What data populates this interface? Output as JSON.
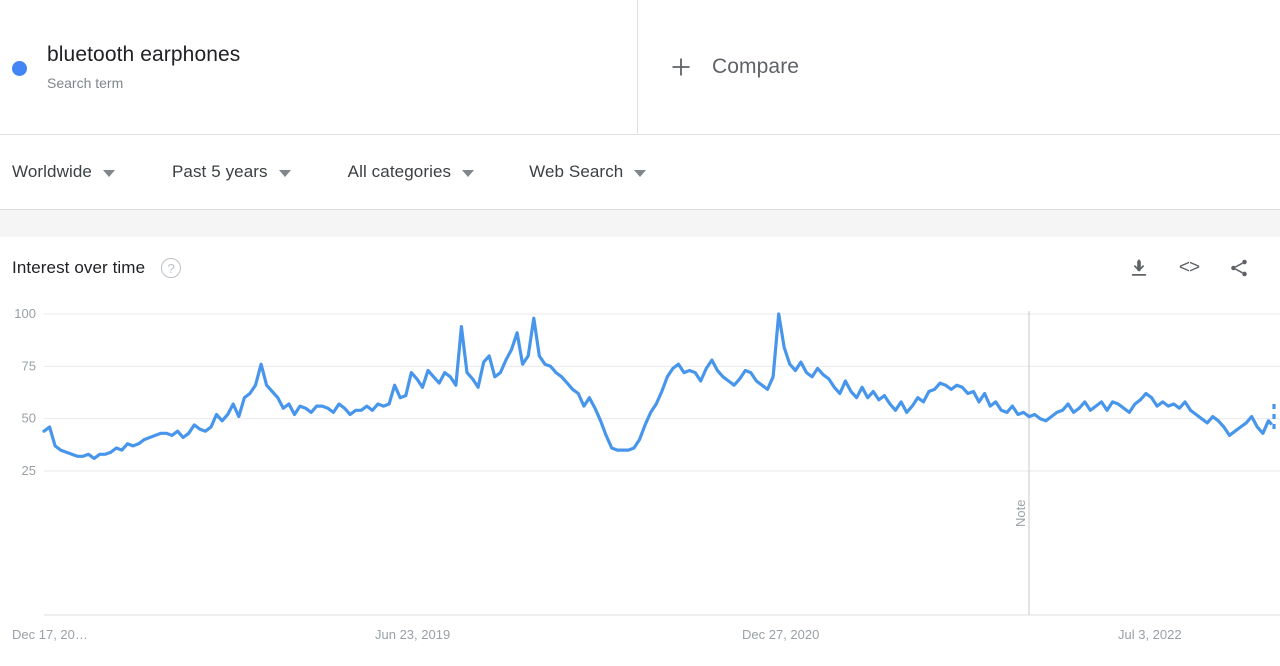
{
  "header": {
    "term": {
      "title": "bluetooth earphones",
      "subtitle": "Search term",
      "dot_color": "#4285f4"
    },
    "compare": {
      "label": "Compare",
      "icon": "plus-icon"
    }
  },
  "filters": [
    {
      "label": "Worldwide",
      "caret": "chevron-down-icon"
    },
    {
      "label": "Past 5 years",
      "caret": "chevron-down-icon"
    },
    {
      "label": "All categories",
      "caret": "chevron-down-icon"
    },
    {
      "label": "Web Search",
      "caret": "chevron-down-icon"
    }
  ],
  "card": {
    "title": "Interest over time",
    "help_icon": "?",
    "actions": [
      {
        "name": "download-icon",
        "glyph": "download"
      },
      {
        "name": "embed-icon",
        "glyph": "<>"
      },
      {
        "name": "share-icon",
        "glyph": "share"
      }
    ]
  },
  "chart_data": {
    "type": "line",
    "title": "Interest over time",
    "xlabel": "",
    "ylabel": "",
    "ylim": [
      0,
      100
    ],
    "yticks": [
      100,
      75,
      50,
      25
    ],
    "grid": true,
    "legend": "none",
    "line_color": "#4896ec",
    "xtick_labels": [
      "Dec 17, 20…",
      "Jun 23, 2019",
      "Dec 27, 2020",
      "Jul 3, 2022"
    ],
    "annotations": [
      {
        "label": "Note",
        "orientation": "vertical",
        "x_fraction": 0.797
      }
    ],
    "partial_last_point": true,
    "series": [
      {
        "name": "bluetooth earphones",
        "values": [
          44,
          46,
          37,
          35,
          34,
          33,
          32,
          32,
          33,
          31,
          33,
          33,
          34,
          36,
          35,
          38,
          37,
          38,
          40,
          41,
          42,
          43,
          43,
          42,
          44,
          41,
          43,
          47,
          45,
          44,
          46,
          52,
          49,
          52,
          57,
          51,
          60,
          62,
          66,
          76,
          66,
          63,
          60,
          55,
          57,
          52,
          56,
          55,
          53,
          56,
          56,
          55,
          53,
          57,
          55,
          52,
          54,
          54,
          56,
          54,
          57,
          56,
          57,
          66,
          60,
          61,
          72,
          69,
          65,
          73,
          70,
          67,
          72,
          70,
          66,
          94,
          72,
          69,
          65,
          77,
          80,
          70,
          72,
          78,
          83,
          91,
          76,
          80,
          98,
          80,
          76,
          75,
          72,
          70,
          67,
          64,
          62,
          56,
          60,
          55,
          49,
          42,
          36,
          35,
          35,
          35,
          36,
          40,
          47,
          53,
          57,
          63,
          70,
          74,
          76,
          72,
          73,
          72,
          68,
          74,
          78,
          73,
          70,
          68,
          66,
          69,
          73,
          72,
          68,
          66,
          64,
          70,
          100,
          84,
          76,
          73,
          77,
          72,
          70,
          74,
          71,
          69,
          65,
          62,
          68,
          63,
          60,
          65,
          60,
          63,
          59,
          61,
          57,
          54,
          58,
          53,
          56,
          60,
          58,
          63,
          64,
          67,
          66,
          64,
          66,
          65,
          62,
          63,
          58,
          62,
          56,
          58,
          54,
          53,
          56,
          52,
          53,
          51,
          52,
          50,
          49,
          51,
          53,
          54,
          57,
          53,
          55,
          58,
          54,
          56,
          58,
          54,
          58,
          57,
          55,
          53,
          57,
          59,
          62,
          60,
          56,
          58,
          56,
          57,
          55,
          58,
          54,
          52,
          50,
          48,
          51,
          49,
          46,
          42,
          44,
          46,
          48,
          51,
          46,
          43,
          49,
          46
        ]
      }
    ]
  }
}
